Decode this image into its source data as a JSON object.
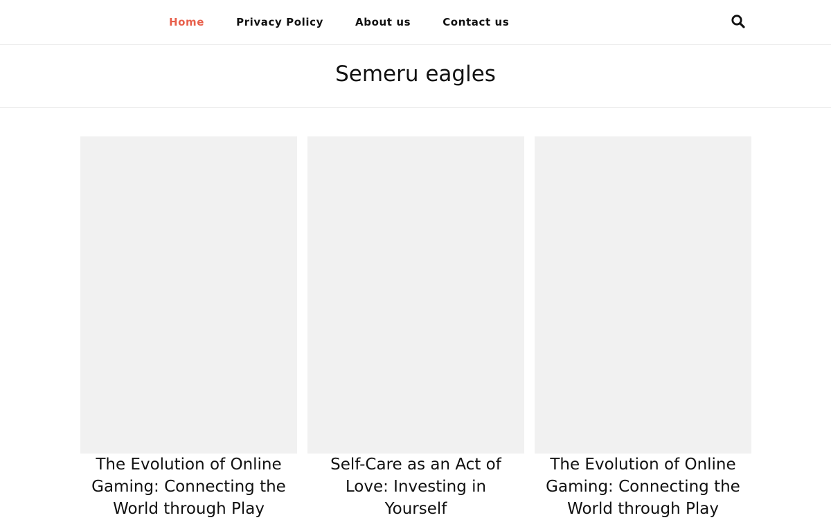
{
  "nav": {
    "items": [
      {
        "label": "Home",
        "active": true
      },
      {
        "label": "Privacy Policy",
        "active": false
      },
      {
        "label": "About us",
        "active": false
      },
      {
        "label": "Contact us",
        "active": false
      }
    ],
    "search_icon": "search-icon"
  },
  "site": {
    "title": "Semeru eagles"
  },
  "posts": [
    {
      "title": "The Evolution of Online Gaming: Connecting the World through Play"
    },
    {
      "title": "Self-Care as an Act of Love: Investing in Yourself"
    },
    {
      "title": "The Evolution of Online Gaming: Connecting the World through Play"
    }
  ],
  "colors": {
    "accent": "#e8604c",
    "text": "#111111",
    "thumb_bg": "#f1f1f1",
    "divider": "#ececec"
  }
}
